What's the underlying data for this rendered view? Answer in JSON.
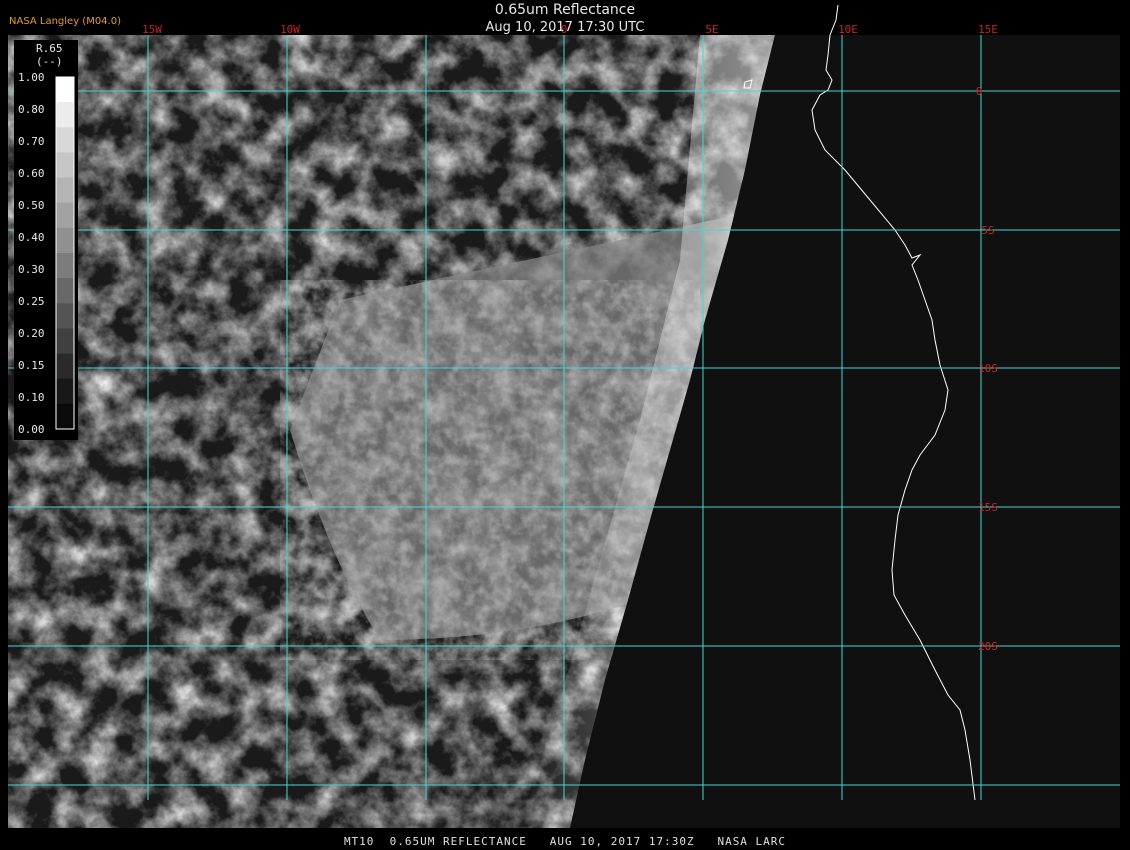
{
  "header": {
    "title": "0.65um Reflectance",
    "subtitle": "Aug 10, 2017 17:30 UTC",
    "producer": "NASA Langley (M04.0)"
  },
  "footer": {
    "caption": "MT10  0.65UM REFLECTANCE   AUG 10, 2017 17:30Z   NASA LARC"
  },
  "legend": {
    "variable": "R.65",
    "units": "(--)",
    "ticks": [
      "1.00",
      "0.80",
      "0.70",
      "0.60",
      "0.50",
      "0.40",
      "0.30",
      "0.25",
      "0.20",
      "0.15",
      "0.10",
      "0.00"
    ],
    "gray_levels": [
      "#ffffff",
      "#ececec",
      "#d8d8d8",
      "#c6c6c6",
      "#b4b4b4",
      "#a2a2a2",
      "#909090",
      "#7c7c7c",
      "#686868",
      "#545454",
      "#404040",
      "#2a2a2a",
      "#181818",
      "#0a0a0a"
    ]
  },
  "grid": {
    "longitude_labels": [
      "15W",
      "10W",
      "0",
      "5E",
      "10E",
      "15E"
    ],
    "latitude_labels": [
      "0",
      "5S",
      "10S",
      "15S",
      "20S"
    ],
    "line_color": "#40d8d8",
    "label_color": "#cc2020"
  },
  "colors": {
    "background": "#000000",
    "coastline": "#ffffff",
    "producer_text": "#e0a020"
  }
}
